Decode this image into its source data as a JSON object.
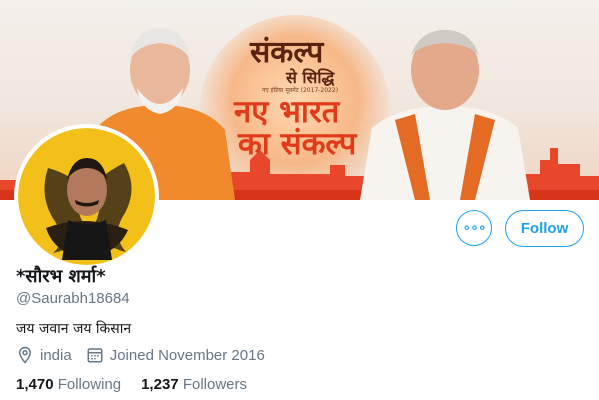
{
  "banner": {
    "logo_title": "संकल्प",
    "logo_subtitle": "से सिद्धि",
    "logo_small": "नए इंडिया मूवमेंट (2017-2022)",
    "headline_line1": "नए भारत",
    "headline_line2": "का संकल्प"
  },
  "profile": {
    "display_name": "*सौरभ शर्मा*",
    "handle": "@Saurabh18684",
    "bio": "जय जवान जय किसान",
    "location": "india",
    "joined": "Joined November 2016"
  },
  "actions": {
    "more_label": "∘∘∘",
    "follow_label": "Follow"
  },
  "stats": {
    "following_count": "1,470",
    "following_label": "Following",
    "followers_count": "1,237",
    "followers_label": "Followers"
  },
  "colors": {
    "accent": "#1da1f2",
    "text_primary": "#14171a",
    "text_secondary": "#657786",
    "banner_saffron": "#e13a18",
    "avatar_bg": "#f2c019"
  }
}
